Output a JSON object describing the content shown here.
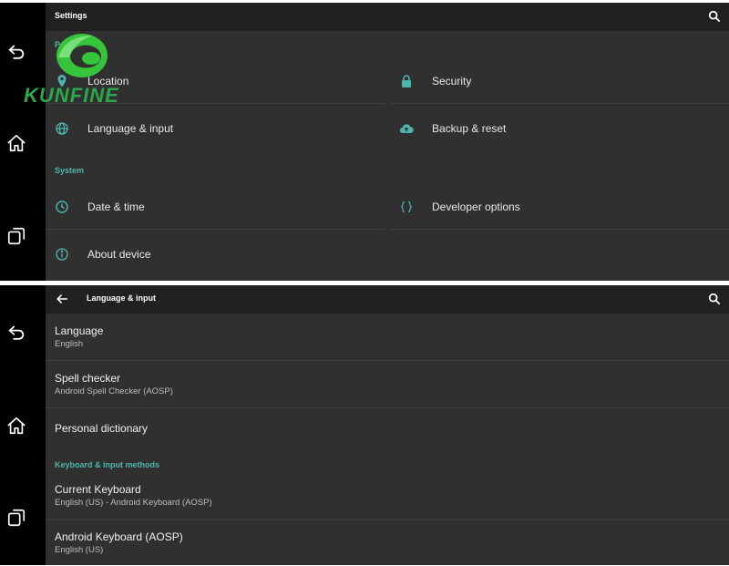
{
  "accent_color": "#4db6ac",
  "nav_icons": [
    "back-arrow-icon",
    "home-icon",
    "recent-apps-icon"
  ],
  "logo": {
    "text": "KUNFINE",
    "colors": [
      "#2ecc40",
      "#2aa84a"
    ]
  },
  "settings_screen": {
    "title": "Settings",
    "section_personal": "Pe",
    "section_system": "System",
    "items": {
      "location": "Location",
      "security": "Security",
      "language_input": "Language & input",
      "backup_reset": "Backup & reset",
      "date_time": "Date & time",
      "developer_options": "Developer options",
      "about_device": "About device"
    }
  },
  "language_screen": {
    "title": "Language & input",
    "language": {
      "title": "Language",
      "summary": "English"
    },
    "spell_checker": {
      "title": "Spell checker",
      "summary": "Android Spell Checker (AOSP)"
    },
    "personal_dictionary": {
      "title": "Personal dictionary"
    },
    "keyboard_section": "Keyboard & input methods",
    "current_keyboard": {
      "title": "Current Keyboard",
      "summary": "English (US) - Android Keyboard (AOSP)"
    },
    "android_keyboard": {
      "title": "Android Keyboard (AOSP)",
      "summary": "English (US)"
    }
  }
}
